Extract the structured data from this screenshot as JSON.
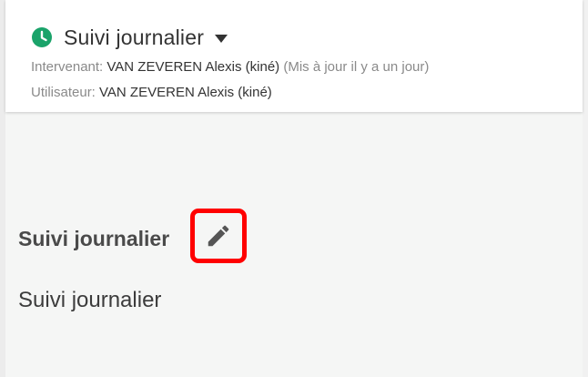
{
  "header": {
    "title": "Suivi journalier",
    "icon": "clock-icon",
    "icon_color": "#1aa36a",
    "intervenant_label": "Intervenant:",
    "intervenant_value": "VAN ZEVEREN Alexis (kiné)",
    "updated_text": "(Mis à jour il y a un jour)",
    "utilisateur_label": "Utilisateur:",
    "utilisateur_value": "VAN ZEVEREN Alexis (kiné)"
  },
  "section": {
    "heading": "Suivi journalier",
    "edit_icon": "pencil-icon",
    "highlight_color": "#ff0000",
    "body": "Suivi journalier"
  }
}
